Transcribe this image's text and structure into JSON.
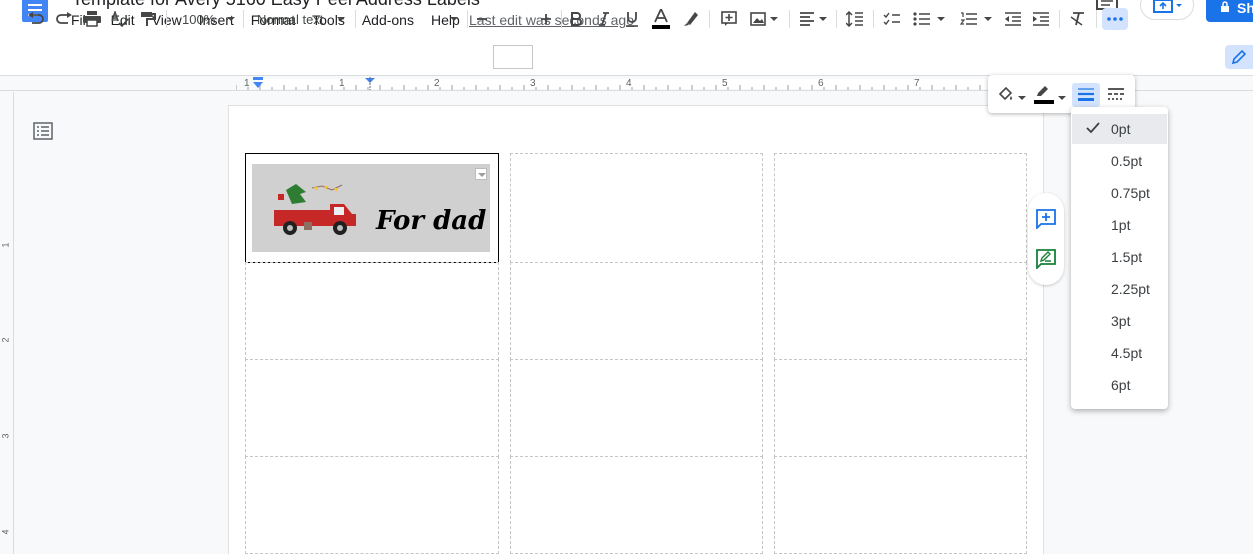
{
  "header": {
    "doc_title": "Template for Avery 5160 Easy Peel Address Labels",
    "last_edit": "Last edit was seconds ago",
    "share_label": "Sh"
  },
  "menu": [
    "File",
    "Edit",
    "View",
    "Insert",
    "Format",
    "Tools",
    "Add-ons",
    "Help"
  ],
  "toolbar": {
    "zoom": "100%",
    "style": "Normal text",
    "font": "",
    "font_size": ""
  },
  "ruler": {
    "h_numbers": [
      "1",
      "1",
      "2",
      "3",
      "4",
      "5",
      "6",
      "7"
    ],
    "v_numbers": [
      "1",
      "2",
      "3",
      "4"
    ]
  },
  "document": {
    "label_text": "For dad"
  },
  "border_width_menu": {
    "options": [
      "0pt",
      "0.5pt",
      "0.75pt",
      "1pt",
      "1.5pt",
      "2.25pt",
      "3pt",
      "4.5pt",
      "6pt"
    ],
    "selected": "0pt"
  },
  "colors": {
    "accent": "#1a73e8",
    "doc_icon": "#4285f4",
    "active_bg": "#d3e3fd",
    "add_comment": "#1a73e8",
    "suggest": "#188038"
  },
  "icons": [
    "docs-logo-icon",
    "comment-history-icon",
    "present-icon",
    "lock-icon",
    "undo-icon",
    "redo-icon",
    "print-icon",
    "spellcheck-icon",
    "paint-format-icon",
    "bold-icon",
    "italic-icon",
    "underline-icon",
    "text-color-icon",
    "highlight-icon",
    "insert-link-icon",
    "insert-image-icon",
    "align-icon",
    "line-spacing-icon",
    "checklist-icon",
    "bulleted-list-icon",
    "numbered-list-icon",
    "decrease-indent-icon",
    "increase-indent-icon",
    "clear-formatting-icon",
    "more-icon",
    "edit-mode-icon",
    "outline-icon",
    "add-comment-icon",
    "suggest-edits-icon",
    "fill-color-icon",
    "border-color-icon",
    "border-width-icon",
    "border-dash-icon",
    "check-icon"
  ]
}
